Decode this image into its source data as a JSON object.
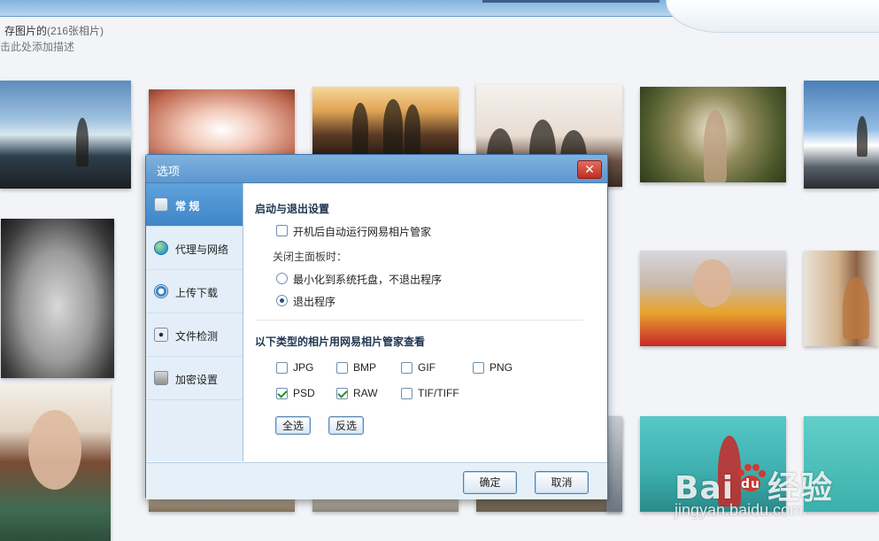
{
  "album": {
    "title": "存图片的",
    "count": "(216张相片)",
    "description_hint": "击此处添加描述"
  },
  "dialog": {
    "title": "选项",
    "close_glyph": "✕",
    "sidebar": [
      {
        "label": "常 规",
        "icon": "general-settings-icon",
        "active": true
      },
      {
        "label": "代理与网络",
        "icon": "globe-network-icon",
        "active": false
      },
      {
        "label": "上传下载",
        "icon": "sync-transfer-icon",
        "active": false
      },
      {
        "label": "文件检测",
        "icon": "eye-scan-icon",
        "active": false
      },
      {
        "label": "加密设置",
        "icon": "lock-icon",
        "active": false
      }
    ],
    "startup": {
      "section_title": "启动与退出设置",
      "autostart_label": "开机后自动运行网易相片管家",
      "autostart_checked": false,
      "on_close_label": "关闭主面板时：",
      "minimize_label": "最小化到系统托盘，不退出程序",
      "minimize_selected": false,
      "exit_label": "退出程序",
      "exit_selected": true
    },
    "file_types": {
      "section_title": "以下类型的相片用网易相片管家查看",
      "types": [
        {
          "label": "JPG",
          "checked": false
        },
        {
          "label": "BMP",
          "checked": false
        },
        {
          "label": "GIF",
          "checked": false
        },
        {
          "label": "PNG",
          "checked": false
        },
        {
          "label": "PSD",
          "checked": true
        },
        {
          "label": "RAW",
          "checked": true
        },
        {
          "label": "TIF/TIFF",
          "checked": false
        }
      ],
      "select_all_label": "全选",
      "invert_label": "反选"
    },
    "ok_label": "确定",
    "cancel_label": "取消"
  },
  "watermark": {
    "logo_text_a": "Bai",
    "logo_text_b": "经验",
    "url": "jingyan.baidu.com"
  }
}
